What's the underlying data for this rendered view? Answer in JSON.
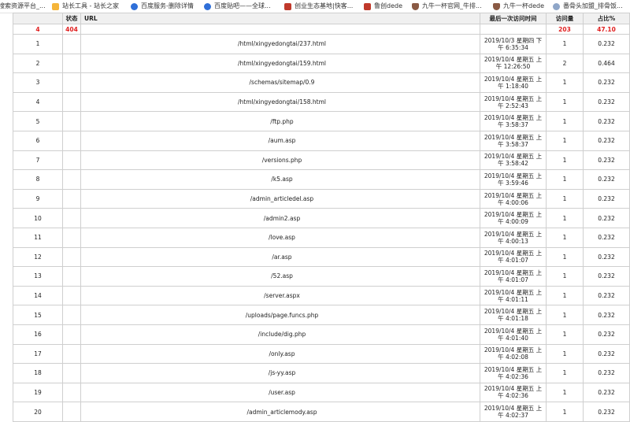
{
  "bookmarks": [
    {
      "label": "搜索资源平台_...",
      "icon": "file-icon"
    },
    {
      "label": "站长工具 - 站长之家",
      "icon": "logo-icon"
    },
    {
      "label": "百度服务-删除详情",
      "icon": "paw-icon"
    },
    {
      "label": "百度贴吧——全球...",
      "icon": "paw-icon"
    },
    {
      "label": "创业生态基地|快客...",
      "icon": "dede-icon"
    },
    {
      "label": "鲁创dede",
      "icon": "dede-icon"
    },
    {
      "label": "九牛一杯官网_牛排...",
      "icon": "shield-icon"
    },
    {
      "label": "九牛一杯dede",
      "icon": "shield-icon"
    },
    {
      "label": "番骨头加盟_排骨饭...",
      "icon": "cloud-icon"
    }
  ],
  "table": {
    "headers": {
      "status": "状态",
      "url": "URL",
      "last_visit": "最后一次访问时间",
      "visits": "访问量",
      "share": "占比%"
    },
    "summary": {
      "index": "4",
      "status": "404",
      "visits": "203",
      "share": "47.10"
    },
    "rows": [
      {
        "index": "1",
        "url": "/html/xingyedongtai/237.html",
        "time": "2019/10/3 星期四 下午 6:35:34",
        "visits": "1",
        "share": "0.232"
      },
      {
        "index": "2",
        "url": "/html/xingyedongtai/159.html",
        "time": "2019/10/4 星期五 上午 12:26:50",
        "visits": "2",
        "share": "0.464"
      },
      {
        "index": "3",
        "url": "/schemas/sitemap/0.9",
        "time": "2019/10/4 星期五 上午 1:18:40",
        "visits": "1",
        "share": "0.232"
      },
      {
        "index": "4",
        "url": "/html/xingyedongtai/158.html",
        "time": "2019/10/4 星期五 上午 2:52:43",
        "visits": "1",
        "share": "0.232"
      },
      {
        "index": "5",
        "url": "/ftp.php",
        "time": "2019/10/4 星期五 上午 3:58:37",
        "visits": "1",
        "share": "0.232"
      },
      {
        "index": "6",
        "url": "/aum.asp",
        "time": "2019/10/4 星期五 上午 3:58:37",
        "visits": "1",
        "share": "0.232"
      },
      {
        "index": "7",
        "url": "/versions.php",
        "time": "2019/10/4 星期五 上午 3:58:42",
        "visits": "1",
        "share": "0.232"
      },
      {
        "index": "8",
        "url": "/k5.asp",
        "time": "2019/10/4 星期五 上午 3:59:46",
        "visits": "1",
        "share": "0.232"
      },
      {
        "index": "9",
        "url": "/admin_articledel.asp",
        "time": "2019/10/4 星期五 上午 4:00:06",
        "visits": "1",
        "share": "0.232"
      },
      {
        "index": "10",
        "url": "/admin2.asp",
        "time": "2019/10/4 星期五 上午 4:00:09",
        "visits": "1",
        "share": "0.232"
      },
      {
        "index": "11",
        "url": "/love.asp",
        "time": "2019/10/4 星期五 上午 4:00:13",
        "visits": "1",
        "share": "0.232"
      },
      {
        "index": "12",
        "url": "/ar.asp",
        "time": "2019/10/4 星期五 上午 4:01:07",
        "visits": "1",
        "share": "0.232"
      },
      {
        "index": "13",
        "url": "/52.asp",
        "time": "2019/10/4 星期五 上午 4:01:07",
        "visits": "1",
        "share": "0.232"
      },
      {
        "index": "14",
        "url": "/server.aspx",
        "time": "2019/10/4 星期五 上午 4:01:11",
        "visits": "1",
        "share": "0.232"
      },
      {
        "index": "15",
        "url": "/uploads/page.funcs.php",
        "time": "2019/10/4 星期五 上午 4:01:18",
        "visits": "1",
        "share": "0.232"
      },
      {
        "index": "16",
        "url": "/include/dig.php",
        "time": "2019/10/4 星期五 上午 4:01:40",
        "visits": "1",
        "share": "0.232"
      },
      {
        "index": "17",
        "url": "/only.asp",
        "time": "2019/10/4 星期五 上午 4:02:08",
        "visits": "1",
        "share": "0.232"
      },
      {
        "index": "18",
        "url": "/js-yy.asp",
        "time": "2019/10/4 星期五 上午 4:02:36",
        "visits": "1",
        "share": "0.232"
      },
      {
        "index": "19",
        "url": "/user.asp",
        "time": "2019/10/4 星期五 上午 4:02:36",
        "visits": "1",
        "share": "0.232"
      },
      {
        "index": "20",
        "url": "/admin_articlemody.asp",
        "time": "2019/10/4 星期五 上午 4:02:37",
        "visits": "1",
        "share": "0.232"
      }
    ]
  }
}
